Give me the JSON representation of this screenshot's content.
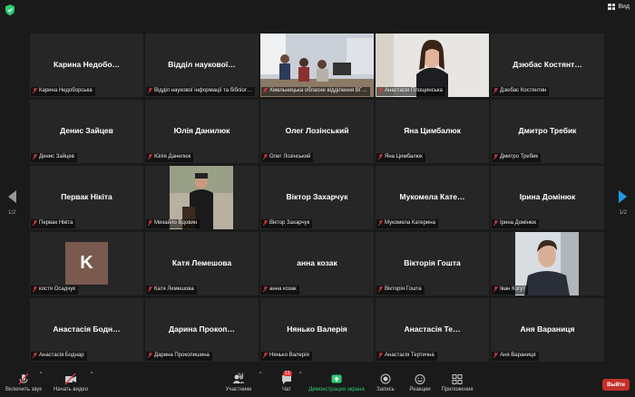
{
  "topbar": {
    "view_label": "Вид"
  },
  "pages": {
    "left": "1/2",
    "right": "1/2"
  },
  "tiles": [
    {
      "name": "Карина  Недобо…",
      "label": "Карина Недоборська"
    },
    {
      "name": "Відділ  наукової…",
      "label": "Відділ наукової інформації та бібліог…"
    },
    {
      "name": "",
      "label": "Хмельницька обласне відділення ВГ…"
    },
    {
      "name": "",
      "label": "Анастасія Площинська"
    },
    {
      "name": "Дзюбас  Костянт…",
      "label": "Дзюбас Костянтин"
    },
    {
      "name": "Денис Зайцев",
      "label": "Денис Зайцев"
    },
    {
      "name": "Юлія Данилюк",
      "label": "Юлія Данилюк"
    },
    {
      "name": "Олег Лозінський",
      "label": "Олег Лозінський"
    },
    {
      "name": "Яна Цимбалюк",
      "label": "Яна Цимбалюк"
    },
    {
      "name": "Дмитро Требик",
      "label": "Дмитро Требик"
    },
    {
      "name": "Первак Нікіта",
      "label": "Первак Нікіта"
    },
    {
      "name": "",
      "label": "Михайло Вдовин"
    },
    {
      "name": "Віктор Захарчук",
      "label": "Віктор Захарчук"
    },
    {
      "name": "Мукомела  Кате…",
      "label": "Мукомела Катерина"
    },
    {
      "name": "Ірина Домінюк",
      "label": "Ірина Домінюк"
    },
    {
      "name": "K",
      "label": "костя Осадчук"
    },
    {
      "name": "Катя Лемешова",
      "label": "Катя Лемешова"
    },
    {
      "name": "анна козак",
      "label": "анна козак"
    },
    {
      "name": "Вікторія Гошта",
      "label": "Вікторія Гошта"
    },
    {
      "name": "",
      "label": "Іван Когут"
    },
    {
      "name": "Анастасія  Бодн…",
      "label": "Анастасія  Боднар"
    },
    {
      "name": "Дарина  Прокоп…",
      "label": "Дарина Прокопишина"
    },
    {
      "name": "Нянько Валерія",
      "label": "Нянько Валерія"
    },
    {
      "name": "Анастасія  Те…",
      "label": "Анастасія Тертична"
    },
    {
      "name": "Аня Вараниця",
      "label": "Аня Вараниця"
    }
  ],
  "toolbar": {
    "audio": "Включить звук",
    "video": "Начать видео",
    "participants": "Участники",
    "participants_count": "34",
    "chat": "Чат",
    "chat_badge": "13",
    "share": "Демонстрация экрана",
    "record": "Запись",
    "reactions": "Реакции",
    "apps": "Приложения",
    "leave": "Выйти"
  },
  "colors": {
    "active_border": "#b8e04a",
    "share": "#2ecc71",
    "leave": "#c4302b",
    "muted": "#e0393e"
  }
}
